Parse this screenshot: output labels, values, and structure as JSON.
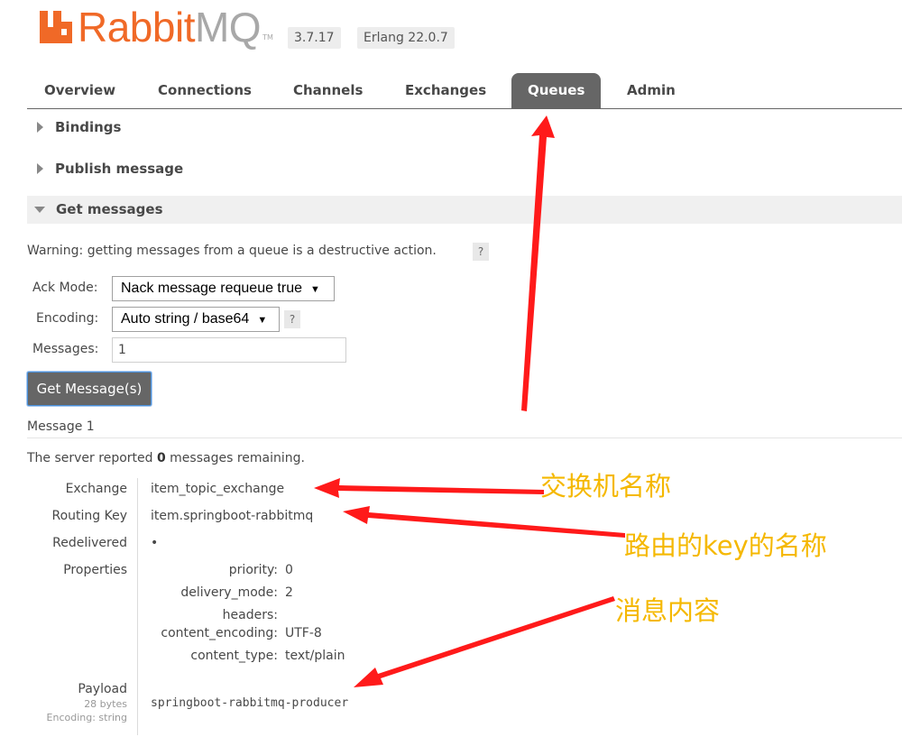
{
  "header": {
    "logo_main": "Rabbit",
    "logo_mq": "MQ",
    "logo_tm": "TM",
    "version": "3.7.17",
    "erlang": "Erlang 22.0.7"
  },
  "tabs": [
    {
      "label": "Overview"
    },
    {
      "label": "Connections"
    },
    {
      "label": "Channels"
    },
    {
      "label": "Exchanges"
    },
    {
      "label": "Queues"
    },
    {
      "label": "Admin"
    }
  ],
  "active_tab": "Queues",
  "sections": {
    "bindings": "Bindings",
    "publish": "Publish message",
    "get": "Get messages"
  },
  "get_messages": {
    "warning": "Warning: getting messages from a queue is a destructive action.",
    "help": "?",
    "ack_mode_label": "Ack Mode:",
    "ack_mode_value": "Nack message requeue true",
    "encoding_label": "Encoding:",
    "encoding_value": "Auto string / base64",
    "messages_label": "Messages:",
    "messages_value": "1",
    "button": "Get Message(s)",
    "dropdown_arrow": "▼"
  },
  "message": {
    "title": "Message 1",
    "server_prefix": "The server reported ",
    "remaining_count": "0",
    "server_suffix": " messages remaining.",
    "exchange_label": "Exchange",
    "exchange_value": "item_topic_exchange",
    "routing_key_label": "Routing Key",
    "routing_key_value": "item.springboot-rabbitmq",
    "redelivered_label": "Redelivered",
    "redelivered_value": "•",
    "properties_label": "Properties",
    "properties": [
      {
        "key": "priority:",
        "value": "0"
      },
      {
        "key": "delivery_mode:",
        "value": "2"
      },
      {
        "key": "headers:",
        "value": ""
      },
      {
        "key": "content_encoding:",
        "value": "UTF-8"
      },
      {
        "key": "content_type:",
        "value": "text/plain"
      }
    ],
    "payload_label": "Payload",
    "payload_size": "28 bytes",
    "payload_encoding": "Encoding: string",
    "payload_value": "springboot-rabbitmq-producer"
  },
  "annotations": {
    "exchange_name": "交换机名称",
    "routing_key_name": "路由的key的名称",
    "message_content": "消息内容"
  },
  "colors": {
    "logo_orange": "#f06927",
    "logo_grey": "#a8a8a8",
    "tab_active": "#666666",
    "annotation_yellow": "#f5b800",
    "arrow_red": "#ff1a1a"
  }
}
